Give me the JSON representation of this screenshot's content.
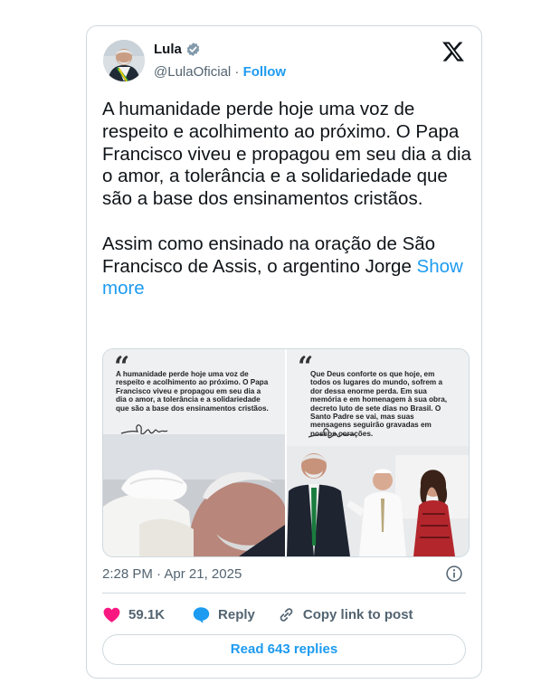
{
  "author": {
    "name": "Lula",
    "handle": "@LulaOficial",
    "separator": " · ",
    "follow_label": "Follow"
  },
  "tweet": {
    "text": "A humanidade perde hoje uma voz de respeito e acolhimento ao próximo. O Papa Francisco viveu e propagou em seu dia a dia o amor, a tolerância e a solidariedade que são a base dos ensinamentos cristãos.\n\nAssim como ensinado na oração de São Francisco de Assis, o argentino Jorge ",
    "show_more": "Show more"
  },
  "media": {
    "left_quote": "A humanidade perde hoje uma voz de respeito e acolhimento ao próximo. O Papa Francisco viveu e propagou em seu dia a dia o amor, a tolerância e a solidariedade que são a base dos ensinamentos cristãos.",
    "right_quote": "Que Deus conforte os que hoje, em todos os lugares do mundo, sofrem a dor dessa enorme perda. Em sua memória e em homenagem à sua obra, decreto luto de sete dias no Brasil. O Santo Padre se vai, mas suas mensagens seguirão gravadas em nossos corações.",
    "quote_mark": "“"
  },
  "meta": {
    "time": "2:28 PM",
    "date": "Apr 21, 2025",
    "separator": " · "
  },
  "actions": {
    "likes": "59.1K",
    "reply": "Reply",
    "copy": "Copy link to post"
  },
  "read_replies": "Read 643 replies",
  "colors": {
    "accent": "#1d9bf0",
    "heart": "#f91880",
    "muted": "#536471",
    "border": "#cfd9de"
  }
}
